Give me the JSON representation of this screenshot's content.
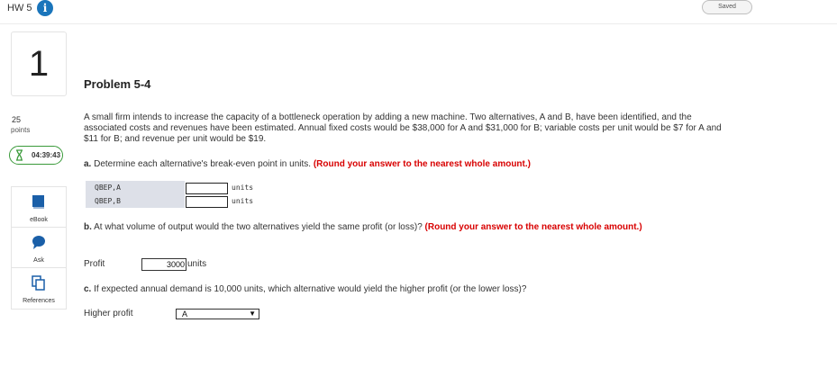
{
  "header": {
    "title": "HW 5",
    "info_icon": "info-icon",
    "saved_label": "Saved"
  },
  "question": {
    "number": "1",
    "points_value": "25",
    "points_label": "points",
    "timer": "04:39:43"
  },
  "tools": [
    {
      "label": "eBook",
      "icon": "book-icon",
      "color": "#1a5fa8"
    },
    {
      "label": "Ask",
      "icon": "chat-bubble-icon",
      "color": "#1a5fa8"
    },
    {
      "label": "References",
      "icon": "copy-icon",
      "color": "#1a5fa8"
    }
  ],
  "problem": {
    "title": "Problem 5-4",
    "statement": "A small firm intends to increase the capacity of a bottleneck operation by adding a new machine. Two alternatives, A and B, have been identified, and the associated costs and revenues have been estimated. Annual fixed costs would be $38,000 for A and $31,000 for B; variable costs per unit would be $7 for A and $11 for B; and revenue per unit would be $19.",
    "part_a": {
      "prefix": "a.",
      "text": "Determine each alternative's break-even point in units.",
      "instruction": "(Round your answer to the nearest whole amount.)",
      "rows": [
        {
          "label": "QBEP,A",
          "value": "",
          "units": "units"
        },
        {
          "label": "QBEP,B",
          "value": "",
          "units": "units"
        }
      ]
    },
    "part_b": {
      "prefix": "b.",
      "text": "At what volume of output would the two alternatives yield the same profit (or loss)?",
      "instruction": "(Round your answer to the nearest whole amount.)",
      "profit_label": "Profit",
      "profit_value": "3000",
      "profit_units": "units"
    },
    "part_c": {
      "prefix": "c.",
      "text": "If expected annual demand is 10,000 units, which alternative would yield the higher profit (or the lower loss)?",
      "higher_profit_label": "Higher profit",
      "higher_profit_value": "A"
    }
  },
  "colors": {
    "accent": "#1a75bb",
    "instruction_red": "#d80000",
    "timer_green": "#3a9a3a",
    "table_shade": "#dde0e8"
  }
}
